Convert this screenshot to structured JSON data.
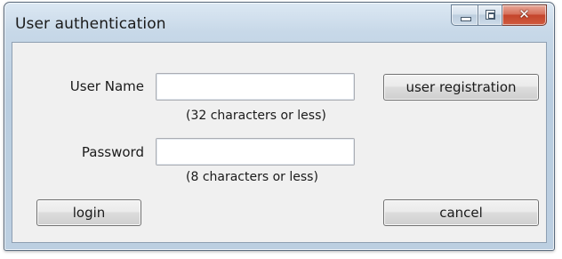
{
  "window": {
    "title": "User authentication"
  },
  "form": {
    "username_label": "User Name",
    "username_value": "",
    "username_hint": "(32 characters or less)",
    "password_label": "Password",
    "password_value": "",
    "password_hint": "(8 characters or less)"
  },
  "buttons": {
    "user_registration": "user registration",
    "login": "login",
    "cancel": "cancel"
  },
  "icons": {
    "minimize": "minimize-icon",
    "maximize": "maximize-icon",
    "close": "close-icon"
  },
  "colors": {
    "close_button": "#c4452c",
    "dialog_background": "#f0f0f0"
  }
}
